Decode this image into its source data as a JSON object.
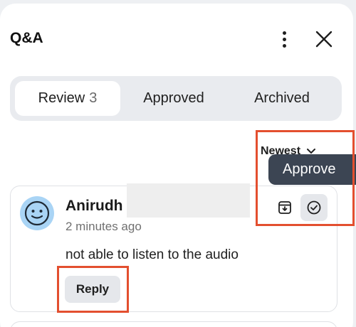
{
  "header": {
    "title": "Q&A",
    "more_icon": "more-vertical-icon",
    "close_icon": "close-icon"
  },
  "tabs": [
    {
      "label": "Review",
      "count": "3",
      "active": true
    },
    {
      "label": "Approved",
      "count": "",
      "active": false
    },
    {
      "label": "Archived",
      "count": "",
      "active": false
    }
  ],
  "sort": {
    "label": "Newest",
    "icon": "chevron-down-icon"
  },
  "tooltip": {
    "text": "Approve"
  },
  "question": {
    "author": "Anirudh",
    "time": "2 minutes ago",
    "text": "not able to listen to the audio",
    "reply_label": "Reply",
    "avatar_icon": "smiley-avatar-icon",
    "archive_icon": "archive-icon",
    "approve_icon": "check-circle-icon"
  },
  "colors": {
    "highlight": "#e34f2f",
    "tooltip_bg": "#3c4553",
    "avatar_bg": "#a9d4f5",
    "tabs_bg": "#e9ebef"
  }
}
